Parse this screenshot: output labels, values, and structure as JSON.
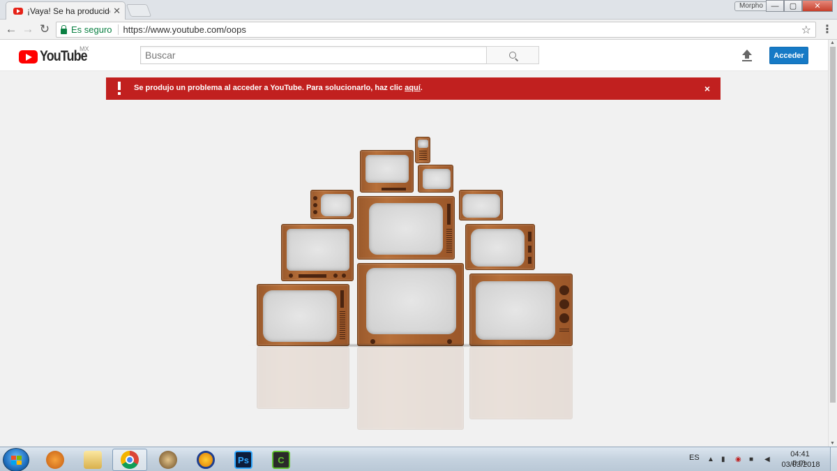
{
  "browser": {
    "tab_title": "¡Vaya! Se ha producido un error",
    "tab_close": "✕",
    "profile_name": "Morpho",
    "window_minimize": "—",
    "window_restore": "▢",
    "window_close": "✕",
    "back_icon": "←",
    "forward_icon": "→",
    "reload_icon": "↻",
    "secure_label": "Es seguro",
    "url": "https://www.youtube.com/oops",
    "bookmark_icon": "☆",
    "menu_icon": "⋮"
  },
  "youtube": {
    "logo_text": "YouTube",
    "country_code": "MX",
    "search_placeholder": "Buscar",
    "signin_label": "Acceder",
    "brand_color": "#ff0000",
    "signin_color": "#167ac6"
  },
  "banner": {
    "message": "Se produjo un problema al acceder a YouTube. Para solucionarlo, haz clic ",
    "link_text": "aquí",
    "message_end": ".",
    "close_label": "×",
    "background_color": "#c1201f"
  },
  "taskbar": {
    "apps": [
      {
        "name": "vlc-icon",
        "active": false
      },
      {
        "name": "file-explorer-icon",
        "active": false
      },
      {
        "name": "chrome-icon",
        "active": true
      },
      {
        "name": "media-player-icon",
        "active": false
      },
      {
        "name": "headphones-app-icon",
        "active": false
      },
      {
        "name": "photoshop-icon",
        "active": false,
        "label": "Ps"
      },
      {
        "name": "camtasia-icon",
        "active": false
      }
    ],
    "language": "ES",
    "clock_time": "04:41 p.m.",
    "clock_date": "03/03/2018"
  }
}
